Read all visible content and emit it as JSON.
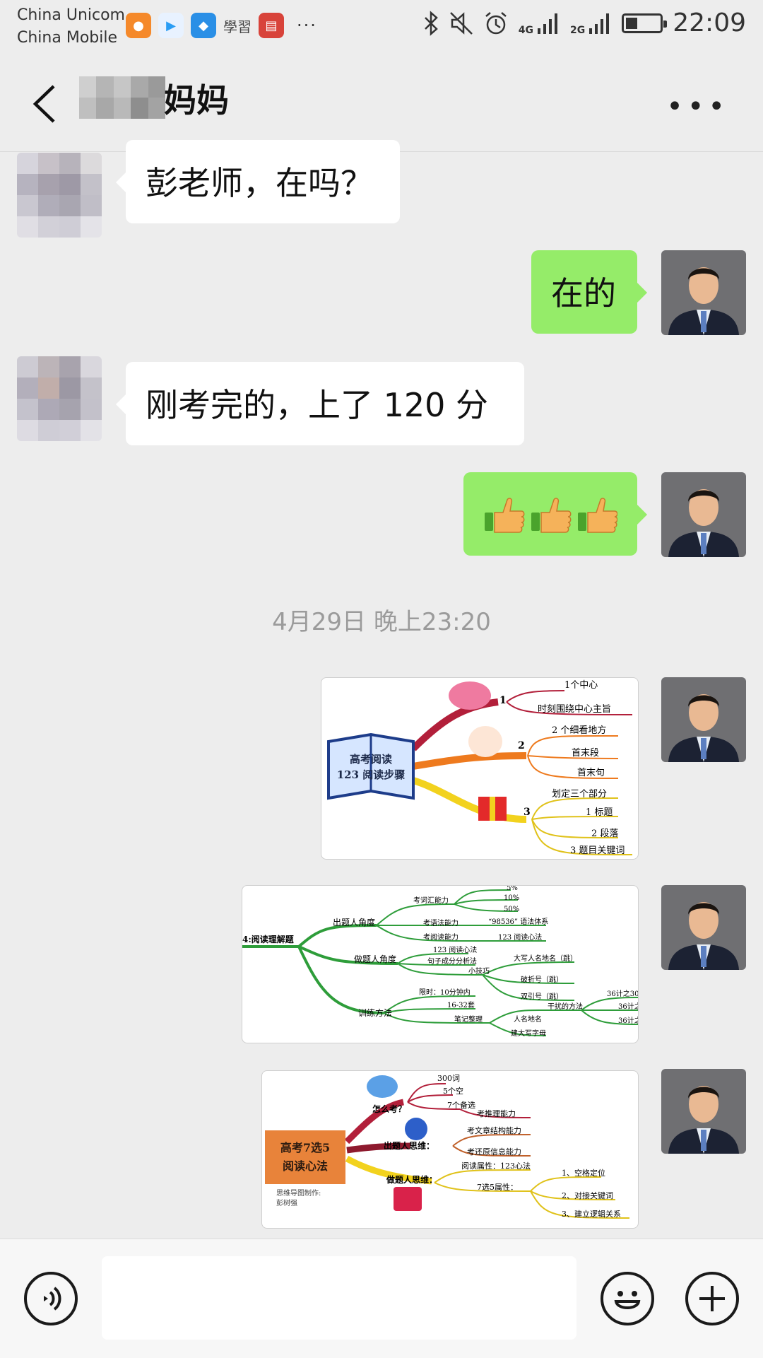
{
  "status_bar": {
    "carrier_1": "China Unicom",
    "carrier_2": "China Mobile",
    "time": "22:09",
    "net_1": "4G",
    "net_2": "2G",
    "battery_level": 0.35,
    "app_icons": [
      "soul-app-icon",
      "video-app-icon",
      "shield-app-icon",
      "xuexi-app-icon",
      "news-app-icon"
    ],
    "xuexi_text": "學習",
    "icons": [
      "bluetooth-icon",
      "mute-icon",
      "alarm-icon",
      "signal-icon",
      "signal-icon",
      "battery-icon"
    ]
  },
  "header": {
    "title": "妈妈",
    "back_icon": "chevron-left-icon",
    "more_icon": "more-icon"
  },
  "messages": {
    "m1": "彭老师，在吗？",
    "m2": "在的",
    "m3": "刚考完的，上了 120 分",
    "m4": "👍👍👍",
    "timestamp": "4月29日 晚上23:20"
  },
  "images": {
    "img1": {
      "center": [
        "高考阅读",
        "123 阅读步骤"
      ],
      "branches": [
        "1",
        "2",
        "3"
      ],
      "leaves": [
        "1个中心",
        "时刻围绕中心主旨",
        "2 个细看地方",
        "首末段",
        "首末句",
        "划定三个部分",
        "1 标题",
        "2 段落",
        "3 题目关键词"
      ]
    },
    "img2": {
      "center": "4:阅读理解题",
      "branches": [
        "出题人角度",
        "做题人角度",
        "训练方法"
      ],
      "leaves": [
        "考词汇能力",
        "5%",
        "10%",
        "50%",
        "考语法能力",
        "“98536” 语法体系",
        "考阅读能力",
        "123 阅读心法",
        "123 阅读心法",
        "句子成分分析法",
        "小技巧",
        "大写人名地名（跳）",
        "破折号（跳）",
        "双引号（跳）",
        "限时：10分钟内",
        "16-32套",
        "笔记整理",
        "人名地名",
        "干扰的方法",
        "建大写字母",
        "36计之30",
        "36计之",
        "36计之"
      ]
    },
    "img3": {
      "center": [
        "高考7选5",
        "阅读心法"
      ],
      "author": [
        "思维导图制作:",
        "彭树强"
      ],
      "branches": [
        "怎么考？",
        "出题人思维：",
        "做题人思维："
      ],
      "leaves": [
        "300词",
        "5个空",
        "7个备选",
        "考推理能力",
        "考文章结构能力",
        "考还原信息能力",
        "阅读属性：123心法",
        "7选5属性：",
        "1、空格定位",
        "2、对接关键词",
        "3、建立逻辑关系"
      ]
    }
  },
  "input_bar": {
    "voice_icon": "voice-icon",
    "emoji_icon": "emoji-icon",
    "plus_icon": "plus-icon",
    "input_value": ""
  },
  "colors": {
    "background": "#ededed",
    "bubble_self": "#95ec69",
    "bubble_other": "#ffffff",
    "timestamp": "#9b9b9b"
  }
}
